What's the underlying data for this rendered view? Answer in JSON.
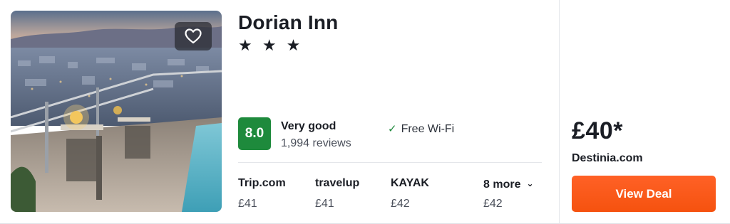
{
  "hotel": {
    "name": "Dorian Inn",
    "stars": "★ ★ ★",
    "score": "8.0",
    "rating_label": "Very good",
    "reviews": "1,994 reviews",
    "amenity": "Free Wi-Fi",
    "colors": {
      "score_badge": "#1e8a3c",
      "deal_button": "#ff5a1f"
    }
  },
  "offers": [
    {
      "provider": "Trip.com",
      "price": "£41"
    },
    {
      "provider": "travelup",
      "price": "£41"
    },
    {
      "provider": "KAYAK",
      "price": "£42"
    }
  ],
  "more": {
    "label": "8 more",
    "price": "£42"
  },
  "deal": {
    "price": "£40*",
    "provider": "Destinia.com",
    "button_label": "View Deal"
  },
  "icons": {
    "favorite": "heart-icon",
    "check": "check-icon",
    "more": "chevron-down-icon"
  }
}
